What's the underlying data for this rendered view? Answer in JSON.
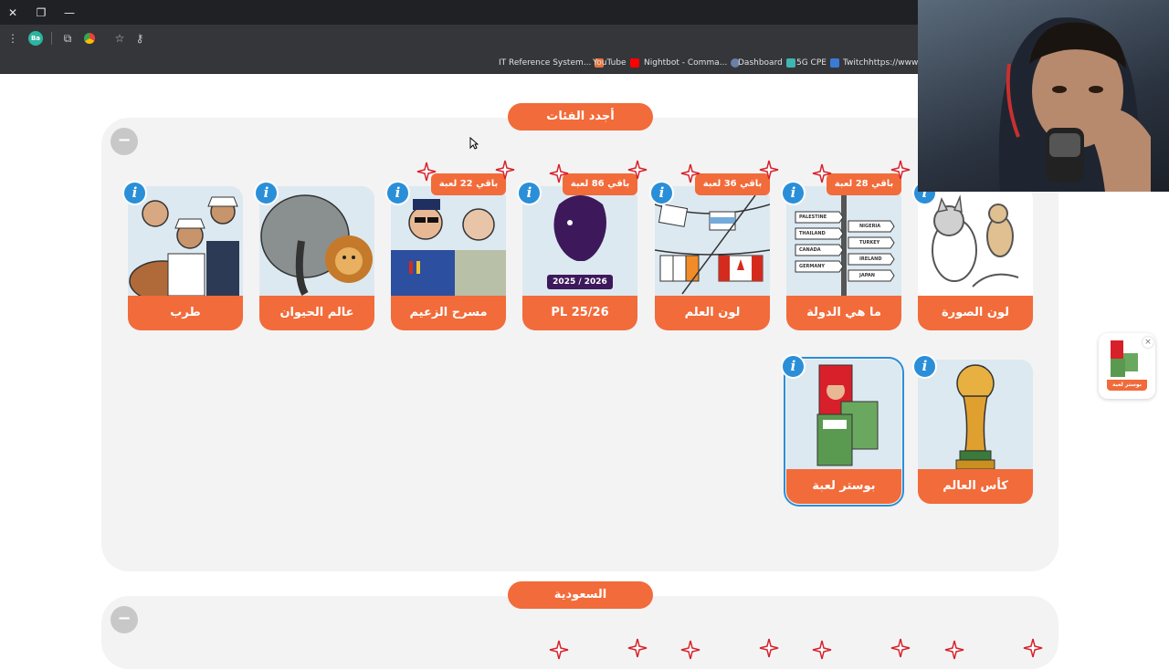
{
  "browser": {
    "profile_initials": "Ba",
    "bookmarks": [
      {
        "label": "IT Reference System...",
        "color": "#e5743a"
      },
      {
        "label": "YouTube",
        "color": "#ff0000"
      },
      {
        "label": "Nightbot - Comma...",
        "color": "#6b7fa8"
      },
      {
        "label": "Dashboard",
        "color": "#3fb6b0"
      },
      {
        "label": "5G CPE",
        "color": "#3a7bd5"
      },
      {
        "label": "Twitchhttps://www.t...",
        "color": "#9146ff"
      }
    ]
  },
  "sections": [
    {
      "title": "أجدد الفئات",
      "collapse_symbol": "−",
      "cards": [
        {
          "label": "لون الصورة",
          "ribbon": ""
        },
        {
          "label": "ما هي الدولة",
          "ribbon": "باقي 28 لعبة"
        },
        {
          "label": "لون العلم",
          "ribbon": "باقي 36 لعبة"
        },
        {
          "label": "PL 25/26",
          "ribbon": "باقي 86 لعبة",
          "art_text": "2025 / 2026"
        },
        {
          "label": "مسرح الزعيم",
          "ribbon": "باقي 22 لعبة"
        },
        {
          "label": "عالم الحيوان",
          "ribbon": ""
        },
        {
          "label": "طرب",
          "ribbon": ""
        },
        {
          "label": "كأس العالم",
          "ribbon": ""
        },
        {
          "label": "بوستر لعبة",
          "ribbon": "",
          "selected": true
        }
      ]
    },
    {
      "title": "السعودية",
      "collapse_symbol": "−"
    }
  ],
  "signposts": [
    "PALESTINE",
    "THAILAND",
    "CANADA",
    "GERMANY",
    "NIGERIA",
    "TURKEY",
    "IRELAND",
    "JAPAN"
  ],
  "floating_thumb": {
    "label": "بوستر لعبة",
    "close_symbol": "×"
  },
  "info_symbol": "i",
  "colors": {
    "accent": "#f26b3a",
    "info": "#2a8fd8",
    "section_bg": "#f3f3f3"
  }
}
